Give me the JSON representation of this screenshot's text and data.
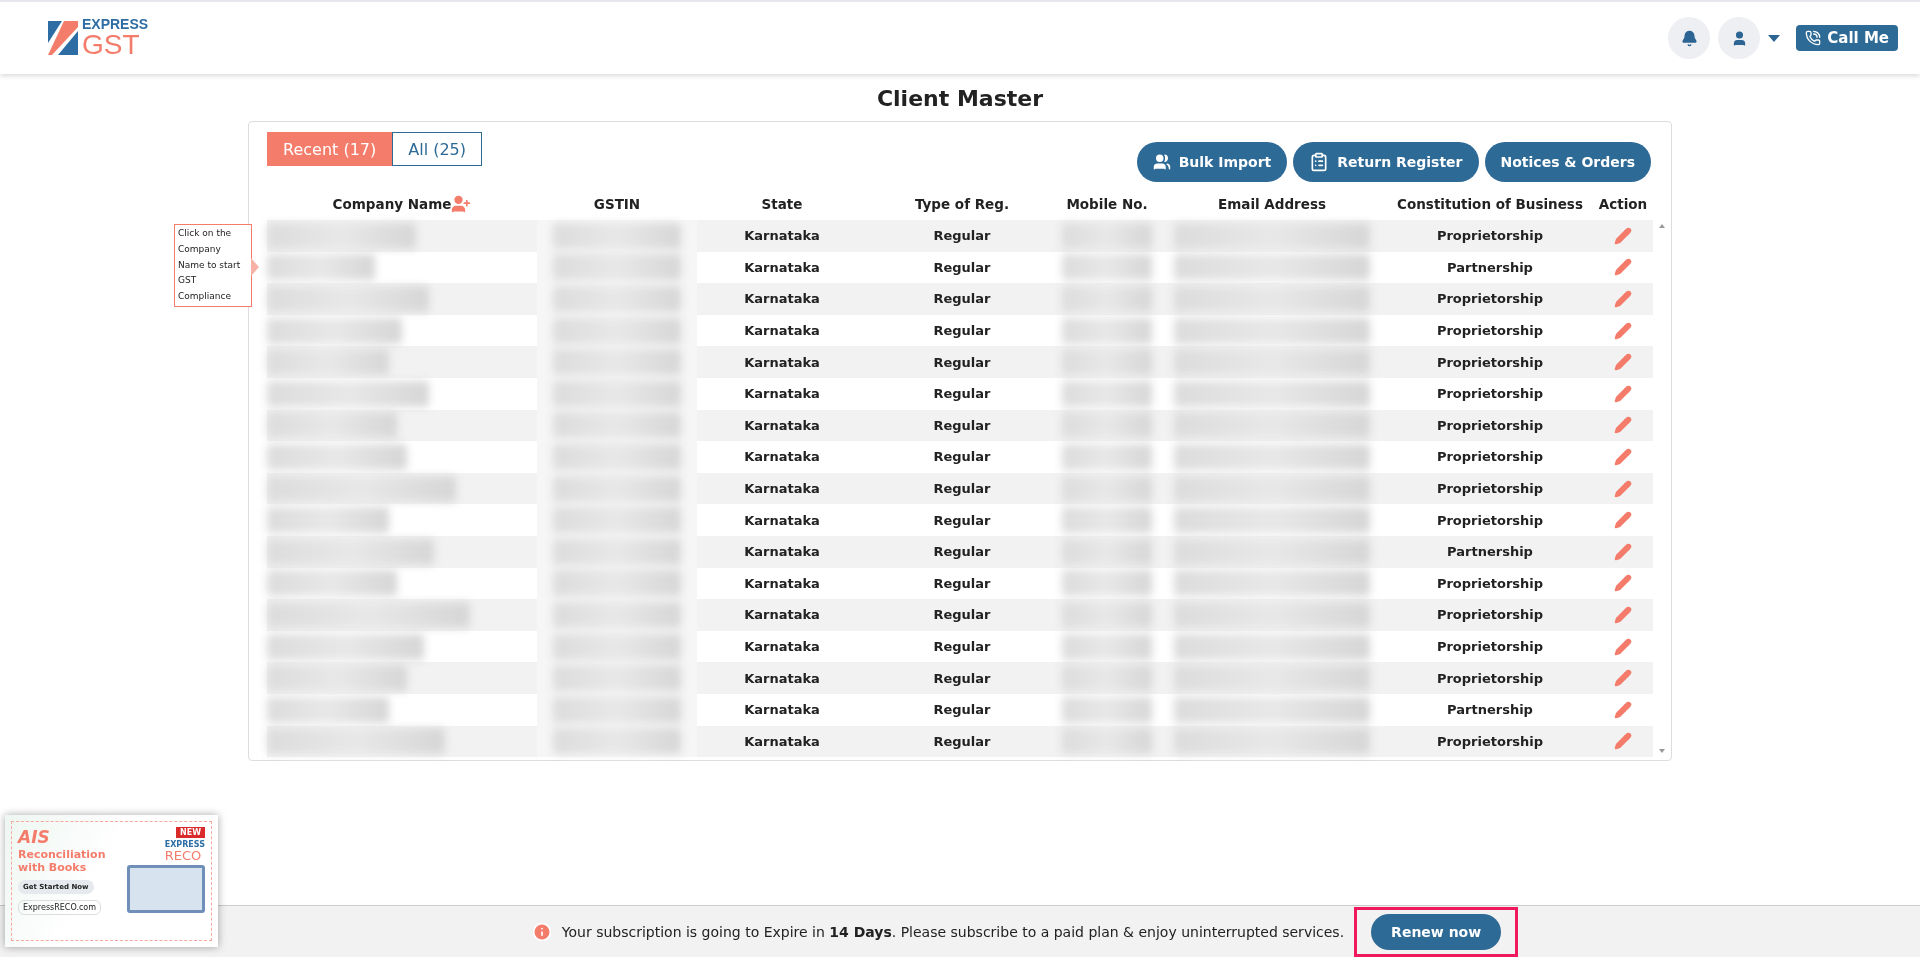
{
  "logo": {
    "line1": "EXPRESS",
    "line2": "GST"
  },
  "header": {
    "call_button": "Call Me"
  },
  "page_title": "Client Master",
  "tabs": [
    {
      "label": "Recent (17)",
      "selected": true
    },
    {
      "label": "All (25)",
      "selected": false
    }
  ],
  "actions": [
    {
      "label": "Bulk Import"
    },
    {
      "label": "Return Register"
    },
    {
      "label": "Notices & Orders"
    }
  ],
  "table": {
    "columns": [
      "Company Name",
      "GSTIN",
      "State",
      "Type of Reg.",
      "Mobile No.",
      "Email Address",
      "Constitution of Business",
      "Action"
    ],
    "rows": [
      {
        "state": "Karnataka",
        "type": "Regular",
        "constitution": "Proprietorship"
      },
      {
        "state": "Karnataka",
        "type": "Regular",
        "constitution": "Partnership"
      },
      {
        "state": "Karnataka",
        "type": "Regular",
        "constitution": "Proprietorship"
      },
      {
        "state": "Karnataka",
        "type": "Regular",
        "constitution": "Proprietorship"
      },
      {
        "state": "Karnataka",
        "type": "Regular",
        "constitution": "Proprietorship"
      },
      {
        "state": "Karnataka",
        "type": "Regular",
        "constitution": "Proprietorship"
      },
      {
        "state": "Karnataka",
        "type": "Regular",
        "constitution": "Proprietorship"
      },
      {
        "state": "Karnataka",
        "type": "Regular",
        "constitution": "Proprietorship"
      },
      {
        "state": "Karnataka",
        "type": "Regular",
        "constitution": "Proprietorship"
      },
      {
        "state": "Karnataka",
        "type": "Regular",
        "constitution": "Proprietorship"
      },
      {
        "state": "Karnataka",
        "type": "Regular",
        "constitution": "Partnership"
      },
      {
        "state": "Karnataka",
        "type": "Regular",
        "constitution": "Proprietorship"
      },
      {
        "state": "Karnataka",
        "type": "Regular",
        "constitution": "Proprietorship"
      },
      {
        "state": "Karnataka",
        "type": "Regular",
        "constitution": "Proprietorship"
      },
      {
        "state": "Karnataka",
        "type": "Regular",
        "constitution": "Proprietorship"
      },
      {
        "state": "Karnataka",
        "type": "Regular",
        "constitution": "Partnership"
      },
      {
        "state": "Karnataka",
        "type": "Regular",
        "constitution": "Proprietorship"
      }
    ]
  },
  "hint": "Click on the Company Name to start GST Compliance",
  "ad": {
    "badge": "NEW",
    "headline_1": "AIS",
    "headline_2": "Reconciliation with Books",
    "cta": "Get Started Now",
    "brand_1": "EXPRESS",
    "brand_2": "RECO",
    "site": "ExpressRECO.com"
  },
  "banner": {
    "message": "Your subscription is going to Expire in **14 Days**. Please subscribe to a paid plan & enjoy uninterrupted services.",
    "button": "Renew now"
  }
}
